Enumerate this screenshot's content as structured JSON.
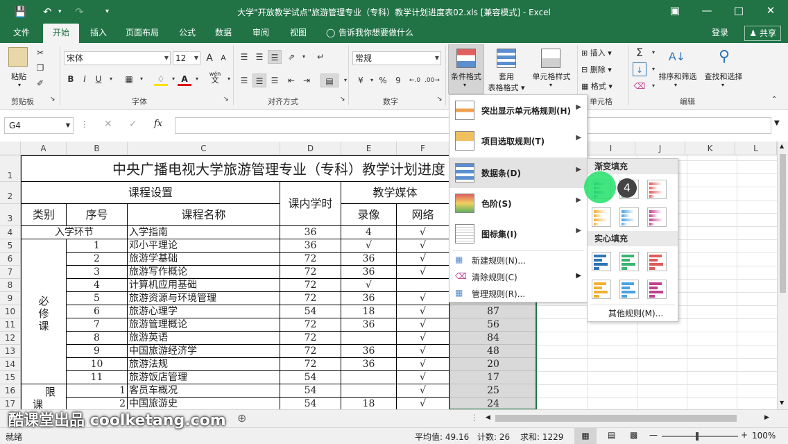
{
  "window": {
    "title": "大学\"开放教学试点\"旅游管理专业（专科）教学计划进度表02.xls  [兼容模式] - Excel"
  },
  "tabs": [
    "文件",
    "开始",
    "插入",
    "页面布局",
    "公式",
    "数据",
    "审阅",
    "视图"
  ],
  "tell_me": "告诉我你想要做什么",
  "login": "登录",
  "share": "共享",
  "ribbon": {
    "paste": "粘贴",
    "font_name": "宋体",
    "font_size": "12",
    "number_format": "常规",
    "cond_format": "条件格式",
    "table_format_1": "套用",
    "table_format_2": "表格格式",
    "cell_style": "单元格样式",
    "insert": "插入",
    "delete": "删除",
    "format": "格式",
    "sort_filter": "排序和筛选",
    "find_select": "查找和选择",
    "groups": {
      "clipboard": "剪贴板",
      "font": "字体",
      "align": "对齐方式",
      "number": "数字",
      "cells": "单元格",
      "edit": "编辑"
    },
    "wen": "wén",
    "wen_char": "文",
    "percent": "%",
    "comma": "9",
    "bold": "B",
    "italic": "I",
    "underline": "U"
  },
  "namebox": "G4",
  "fx": "fx",
  "columns": [
    "A",
    "B",
    "C",
    "D",
    "E",
    "F",
    "G",
    "H",
    "I",
    "J",
    "K",
    "L"
  ],
  "rows": [
    "1",
    "2",
    "3",
    "4",
    "5",
    "6",
    "7",
    "8",
    "9",
    "10",
    "11",
    "12",
    "13",
    "14",
    "15",
    "16",
    "17"
  ],
  "sheet": {
    "title": "中央广播电视大学旅游管理专业（专科）教学计划进度",
    "h_course_setup": "课程设置",
    "h_hours": "课内学时",
    "h_media": "教学媒体",
    "h_category": "类别",
    "h_seq": "序号",
    "h_course_name": "课程名称",
    "h_video": "录像",
    "h_network": "网络",
    "row4": {
      "cat": "入学环节",
      "name": "入学指南",
      "hours": "36",
      "video": "4",
      "net": "√"
    },
    "required_label": "必\n修\n课",
    "required": [
      {
        "seq": "1",
        "name": "邓小平理论",
        "hours": "36",
        "video": "√",
        "net": "√",
        "g": ""
      },
      {
        "seq": "2",
        "name": "旅游学基础",
        "hours": "72",
        "video": "36",
        "net": "√",
        "g": ""
      },
      {
        "seq": "3",
        "name": "旅游写作概论",
        "hours": "72",
        "video": "36",
        "net": "√",
        "g": ""
      },
      {
        "seq": "4",
        "name": "计算机应用基础",
        "hours": "72",
        "video": "√",
        "net": "",
        "g": ""
      },
      {
        "seq": "5",
        "name": "旅游资源与环境管理",
        "hours": "72",
        "video": "36",
        "net": "√",
        "g": ""
      },
      {
        "seq": "6",
        "name": "旅游心理学",
        "hours": "54",
        "video": "18",
        "net": "√",
        "g": "87"
      },
      {
        "seq": "7",
        "name": "旅游管理概论",
        "hours": "72",
        "video": "36",
        "net": "√",
        "g": "56"
      },
      {
        "seq": "8",
        "name": "旅游英语",
        "hours": "72",
        "video": "",
        "net": "√",
        "g": "84"
      },
      {
        "seq": "9",
        "name": "中国旅游经济学",
        "hours": "72",
        "video": "36",
        "net": "√",
        "g": "48"
      },
      {
        "seq": "10",
        "name": "旅游法规",
        "hours": "72",
        "video": "36",
        "net": "√",
        "g": "20"
      },
      {
        "seq": "11",
        "name": "旅游饭店管理",
        "hours": "54",
        "video": "",
        "net": "√",
        "g": "17"
      }
    ],
    "elective_label_1": "限",
    "elective_label_2": "课",
    "elective": [
      {
        "seq": "1",
        "name": "客员车概况",
        "hours": "54",
        "video": "",
        "net": "√",
        "g": "25"
      },
      {
        "seq": "2",
        "name": "中国旅游史",
        "hours": "54",
        "video": "18",
        "net": "√",
        "g": "24"
      }
    ]
  },
  "cf_menu": {
    "items": [
      {
        "label": "突出显示单元格规则(H)"
      },
      {
        "label": "项目选取规则(T)"
      },
      {
        "label": "数据条(D)"
      },
      {
        "label": "色阶(S)"
      },
      {
        "label": "图标集(I)"
      }
    ],
    "small": [
      {
        "label": "新建规则(N)..."
      },
      {
        "label": "清除规则(C)"
      },
      {
        "label": "管理规则(R)..."
      }
    ]
  },
  "databar_menu": {
    "gradient": "渐变填充",
    "solid": "实心填充",
    "more": "其他规则(M)...",
    "colors": [
      "#2e75b6",
      "#3cb371",
      "#e05a5a",
      "#f0b030",
      "#4aa0e0",
      "#c04090"
    ]
  },
  "step_badge": "4",
  "status": {
    "ready": "就绪",
    "average": "平均值: 49.16",
    "count": "计数: 26",
    "sum": "求和: 1229",
    "zoom": "100%"
  },
  "watermark": "酷课堂出品 coolketang.com"
}
